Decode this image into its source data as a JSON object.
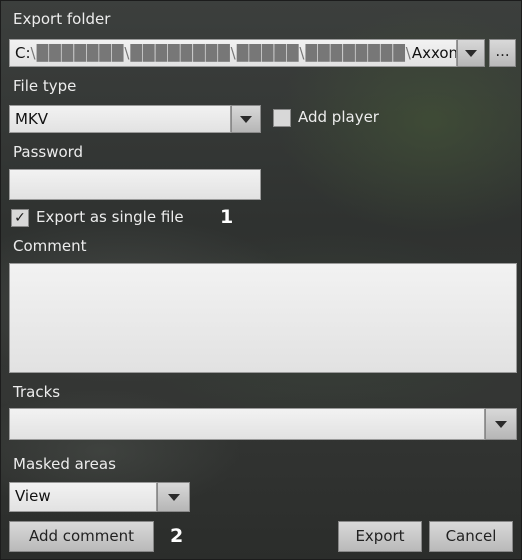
{
  "export_folder": {
    "label": "Export folder",
    "path_prefix": "C:",
    "path_obscured": "\\███████\\████████\\█████\\████████\\",
    "path_suffix": "Axxon",
    "browse_label": "..."
  },
  "file_type": {
    "label": "File type",
    "value": "MKV"
  },
  "add_player": {
    "label": "Add player",
    "checked": false
  },
  "password": {
    "label": "Password",
    "value": ""
  },
  "single_file": {
    "label": "Export as single file",
    "checked": true,
    "check_glyph": "✓"
  },
  "comment": {
    "label": "Comment",
    "value": ""
  },
  "tracks": {
    "label": "Tracks",
    "value": ""
  },
  "masked_areas": {
    "label": "Masked areas",
    "value": "View"
  },
  "buttons": {
    "add_comment": "Add comment",
    "export": "Export",
    "cancel": "Cancel"
  },
  "callouts": {
    "one": "1",
    "two": "2"
  }
}
